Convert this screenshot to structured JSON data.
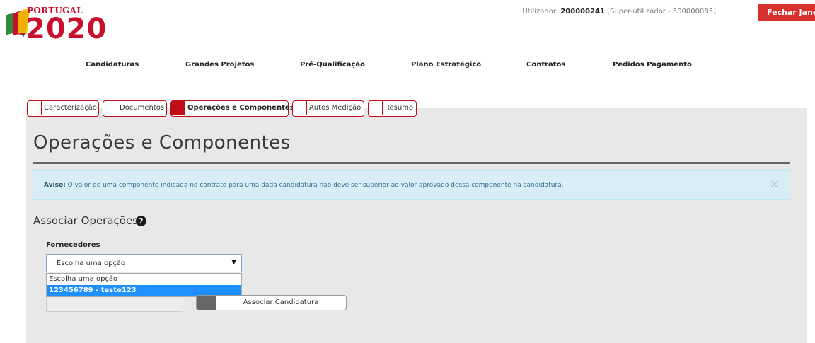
{
  "header": {
    "logo_top": "PORTUGAL",
    "logo_year": "2020",
    "user_label": "Utilizador:",
    "user_id": "200000241",
    "user_role": "[Super-utilizador - 500000085]",
    "close_label": "Fechar Janela"
  },
  "nav": {
    "items": [
      "Candidaturas",
      "Grandes Projetos",
      "Pré-Qualificação",
      "Plano Estratégico",
      "Contratos",
      "Pedidos Pagamento"
    ]
  },
  "tabs": [
    "Caracterização",
    "Documentos",
    "Operações e Componentes",
    "Autos Medição",
    "Resumo"
  ],
  "active_tab": "Operações e Componentes",
  "page": {
    "title": "Operações e Componentes"
  },
  "alert": {
    "label": "Aviso:",
    "text": "O valor de uma componente indicada no contrato para uma dada candidatura não deve ser superior ao valor aprovado dessa componente na candidatura.",
    "close": "×"
  },
  "associar": {
    "title": "Associar Operações",
    "help": "?",
    "fornecedores_label": "Fornecedores",
    "select_value": "Escolha uma opção",
    "options": [
      "Escolha uma opção",
      "123456789 - teste123"
    ],
    "selected_option": "123456789 - teste123",
    "button_label": "Associar Candidatura"
  },
  "colors": {
    "brand_red": "#c00d1a",
    "close_red": "#d6312c",
    "alert_bg": "#d9edf7",
    "option_highlight": "#1e90ff"
  }
}
